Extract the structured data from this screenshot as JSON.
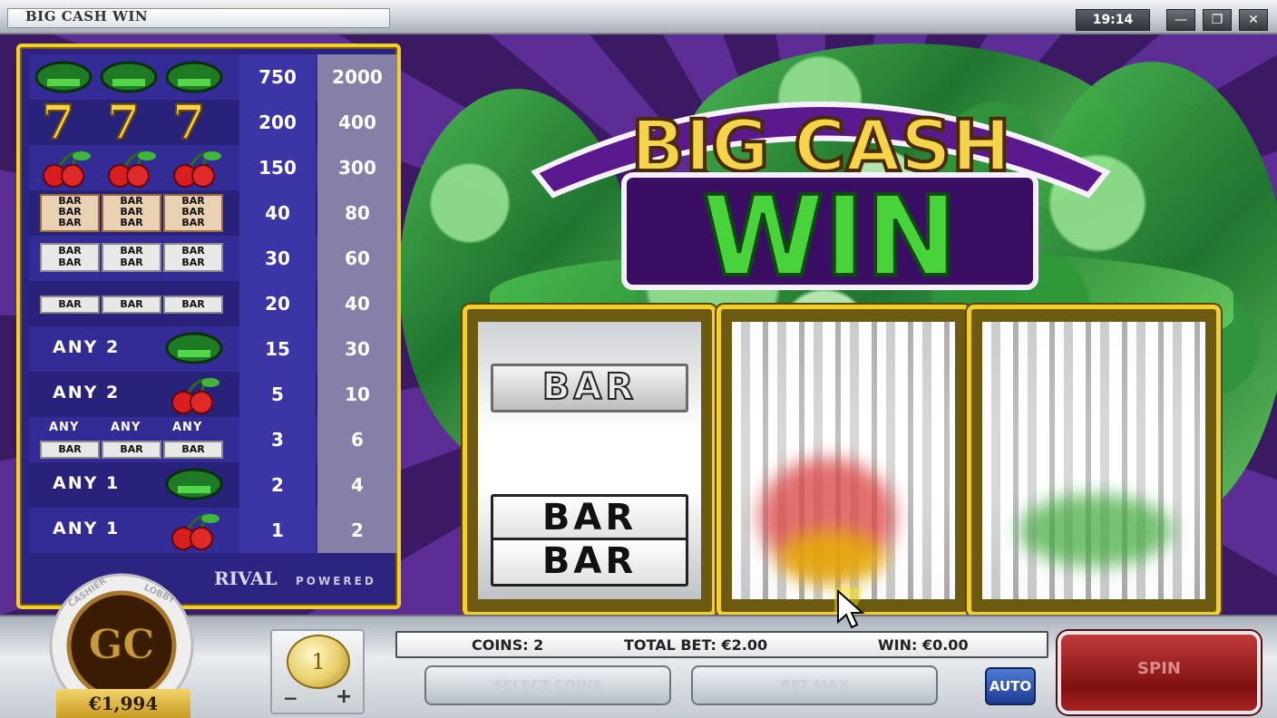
{
  "window": {
    "title": "BIG CASH WIN",
    "clock": "19:14",
    "controls": {
      "minimize": "—",
      "restore": "❐",
      "close": "✕"
    }
  },
  "logo": {
    "line1": "BIG CASH",
    "line2": "WIN"
  },
  "paytable": {
    "rows": [
      {
        "symbol": "big-cash-win-x3",
        "pay1": "750",
        "pay2": "2000"
      },
      {
        "symbol": "seven-x3",
        "pay1": "200",
        "pay2": "400"
      },
      {
        "symbol": "cherry-x3",
        "pay1": "150",
        "pay2": "300"
      },
      {
        "symbol": "triple-bar-x3",
        "pay1": "40",
        "pay2": "80"
      },
      {
        "symbol": "double-bar-x3",
        "pay1": "30",
        "pay2": "60"
      },
      {
        "symbol": "single-bar-x3",
        "pay1": "20",
        "pay2": "40"
      },
      {
        "symbol": "any-2-big-cash-win",
        "pay1": "15",
        "pay2": "30"
      },
      {
        "symbol": "any-2-cherry",
        "pay1": "5",
        "pay2": "10"
      },
      {
        "symbol": "any-bar-x3",
        "pay1": "3",
        "pay2": "6"
      },
      {
        "symbol": "any-1-big-cash-win",
        "pay1": "2",
        "pay2": "4"
      },
      {
        "symbol": "any-1-cherry",
        "pay1": "1",
        "pay2": "2"
      }
    ],
    "any2": "ANY 2",
    "any1": "ANY 1",
    "any": "ANY",
    "bar": "BAR",
    "seven": "7",
    "brand": "RIVAL",
    "powered": "POWERED"
  },
  "reels": {
    "bar_label": "BAR"
  },
  "console": {
    "coins": "COINS: 2",
    "total_bet": "TOTAL BET: €2.00",
    "win": "WIN: €0.00",
    "coin_value": "1",
    "minus": "−",
    "plus": "+",
    "select_coins": "SELECT COINS",
    "bet_max": "BET MAX",
    "auto": "AUTO",
    "spin": "SPIN",
    "balance": "€1,994",
    "chip_cashier": "CASHIER",
    "chip_lobby": "LOBBY",
    "chip_logo": "GC"
  },
  "colors": {
    "gold": "#f2cf2b",
    "purple": "#2b2480",
    "green": "#3fbf3a",
    "spin_red": "#a82222"
  }
}
